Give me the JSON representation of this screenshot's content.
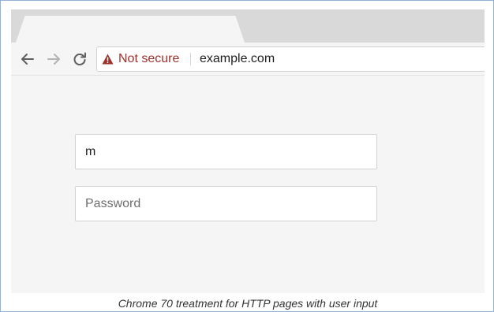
{
  "browser": {
    "nav": {
      "back_icon": "arrow-left-icon",
      "forward_icon": "arrow-right-icon",
      "reload_icon": "reload-icon"
    },
    "omnibox": {
      "security_icon": "warning-triangle-icon",
      "security_label": "Not secure",
      "security_color": "#a0302a",
      "url": "example.com"
    }
  },
  "form": {
    "username_value": "m",
    "password_placeholder": "Password"
  },
  "caption": "Chrome 70 treatment for HTTP pages with user input"
}
